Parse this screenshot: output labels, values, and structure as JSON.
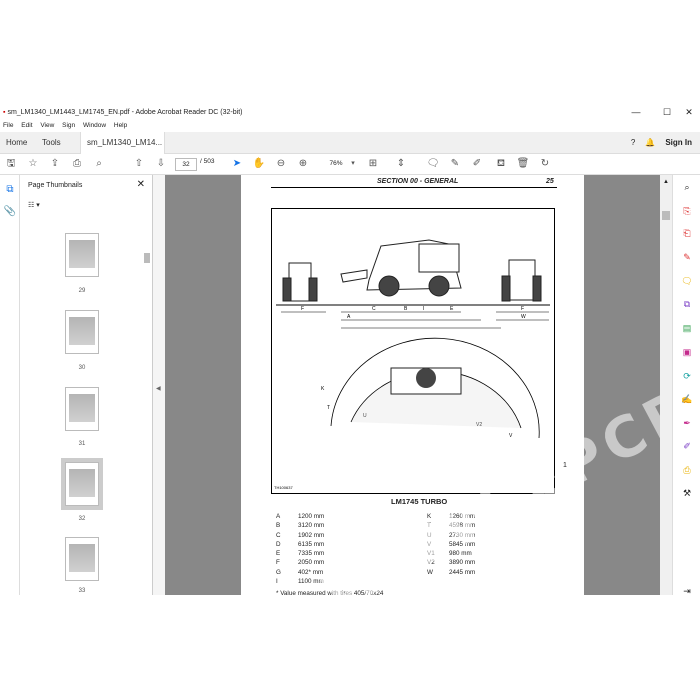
{
  "window": {
    "title": "sm_LM1340_LM1443_LM1745_EN.pdf - Adobe Acrobat Reader DC (32-bit)",
    "min": "—",
    "max": "☐",
    "close": "✕"
  },
  "menu": [
    "File",
    "Edit",
    "View",
    "Sign",
    "Window",
    "Help"
  ],
  "tabs": {
    "home": "Home",
    "tools": "Tools",
    "doc": "sm_LM1340_LM14...",
    "doc_close": "×",
    "sign_in": "Sign In"
  },
  "toolbar": {
    "page_current": "32",
    "page_total": "/ 503",
    "zoom": "76%"
  },
  "thumbnails": {
    "title": "Page Thumbnails",
    "close": "✕",
    "labels": [
      "29",
      "30",
      "31",
      "32",
      "33"
    ],
    "selected": "32"
  },
  "page": {
    "header": "SECTION 00 - GENERAL",
    "page_no": "25",
    "figure_code": "TH100637",
    "figure_no": "1",
    "model": "LM1745 TURBO",
    "left_rows": [
      [
        "A",
        "1200 mm"
      ],
      [
        "B",
        "3120 mm"
      ],
      [
        "C",
        "1902 mm"
      ],
      [
        "D",
        "6135 mm"
      ],
      [
        "E",
        "7335 mm"
      ],
      [
        "F",
        "2050 mm"
      ],
      [
        "G",
        "402* mm"
      ],
      [
        "I",
        "1100 mm"
      ]
    ],
    "right_rows": [
      [
        "K",
        "1260 mm"
      ],
      [
        "T",
        "4598 mm"
      ],
      [
        "U",
        "2730 mm"
      ],
      [
        "V",
        "5845 mm"
      ],
      [
        "V1",
        "980 mm"
      ],
      [
        "V2",
        "3890 mm"
      ],
      [
        "W",
        "2445 mm"
      ]
    ],
    "footnote": "* Value measured with tires 405/70x24"
  },
  "watermark": "WWW.EPCDEO.COM"
}
